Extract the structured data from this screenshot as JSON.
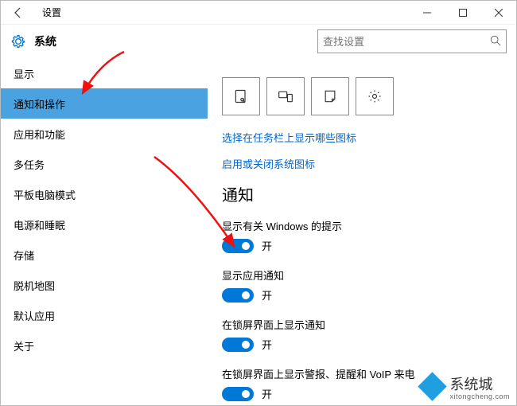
{
  "titlebar": {
    "title": "设置"
  },
  "header": {
    "title": "系统",
    "search_placeholder": "查找设置"
  },
  "sidebar": {
    "items": [
      {
        "label": "显示"
      },
      {
        "label": "通知和操作"
      },
      {
        "label": "应用和功能"
      },
      {
        "label": "多任务"
      },
      {
        "label": "平板电脑模式"
      },
      {
        "label": "电源和睡眠"
      },
      {
        "label": "存储"
      },
      {
        "label": "脱机地图"
      },
      {
        "label": "默认应用"
      },
      {
        "label": "关于"
      }
    ],
    "selected_index": 1
  },
  "content": {
    "quick_action_icons": [
      "tablet-touch",
      "project",
      "note",
      "settings-gear"
    ],
    "link_taskbar": "选择在任务栏上显示哪些图标",
    "link_sysicons": "启用或关闭系统图标",
    "section_title": "通知",
    "toggles": [
      {
        "label": "显示有关 Windows 的提示",
        "state": "开",
        "on": true
      },
      {
        "label": "显示应用通知",
        "state": "开",
        "on": true
      },
      {
        "label": "在锁屏界面上显示通知",
        "state": "开",
        "on": true
      },
      {
        "label": "在锁屏界面上显示警报、提醒和 VoIP 来电",
        "state": "开",
        "on": true
      }
    ]
  },
  "watermark": {
    "brand": "系统城",
    "sub": "xitongcheng.com"
  }
}
